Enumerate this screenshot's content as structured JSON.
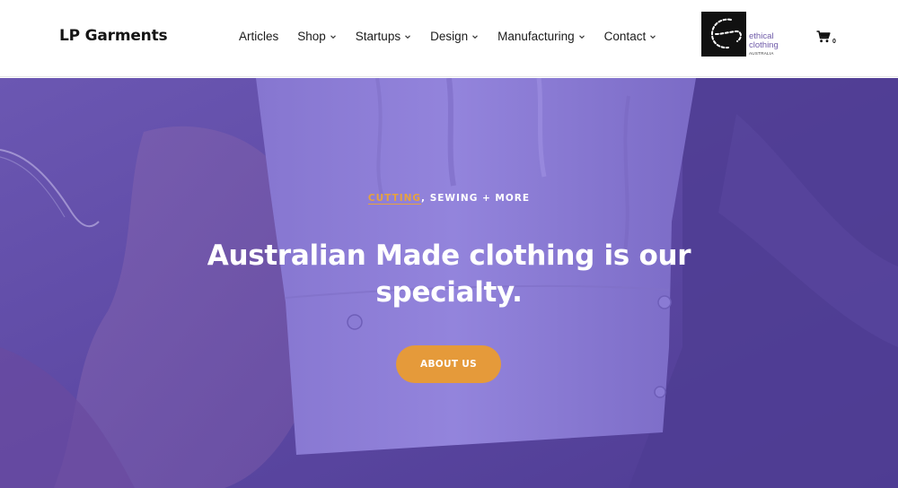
{
  "header": {
    "brand": "LP Garments",
    "nav": [
      {
        "label": "Articles",
        "dropdown": false
      },
      {
        "label": "Shop",
        "dropdown": true
      },
      {
        "label": "Startups",
        "dropdown": true
      },
      {
        "label": "Design",
        "dropdown": true
      },
      {
        "label": "Manufacturing",
        "dropdown": true
      },
      {
        "label": "Contact",
        "dropdown": true
      }
    ],
    "partner_logo": {
      "line1": "ethical",
      "line2": "clothing",
      "line3": "AUSTRALIA"
    },
    "cart": {
      "icon": "cart-icon",
      "count": "0"
    }
  },
  "hero": {
    "kicker_accent": "CUTTING",
    "kicker_rest": ", SEWING + MORE",
    "headline": "Australian Made clothing is our specialty.",
    "cta_label": "ABOUT US"
  },
  "colors": {
    "overlay": "#5f4aa6",
    "accent": "#e59a3a",
    "logo_text": "#6e5aa8"
  }
}
